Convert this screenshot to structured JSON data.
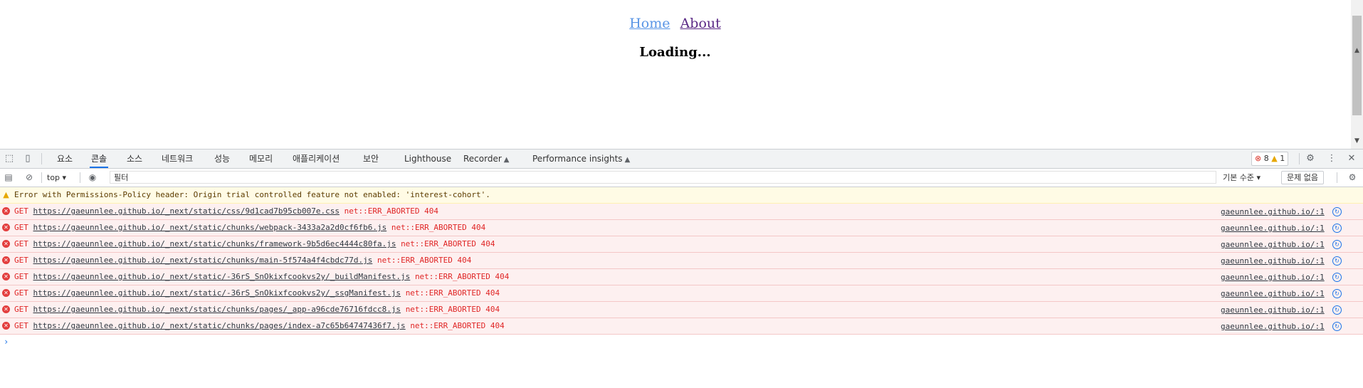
{
  "page": {
    "nav": {
      "home": "Home",
      "about": "About"
    },
    "loading": "Loading..."
  },
  "devtools": {
    "tabs": [
      "요소",
      "콘솔",
      "소스",
      "네트워크",
      "성능",
      "메모리",
      "애플리케이션",
      "보안",
      "Lighthouse",
      "Recorder",
      "Performance insights"
    ],
    "active_tab": "콘솔",
    "error_count": "8",
    "warning_count": "1",
    "toolbar": {
      "context": "top",
      "filter_value": "필터",
      "level": "기본 수준",
      "issues": "문제 없음"
    },
    "warning_row": "Error with Permissions-Policy header: Origin trial controlled feature not enabled: 'interest-cohort'.",
    "error_rows": [
      {
        "method": "GET",
        "url": "https://gaeunnlee.github.io/_next/static/css/9d1cad7b95cb007e.css",
        "status": "net::ERR_ABORTED 404",
        "source": "gaeunnlee.github.io/:1"
      },
      {
        "method": "GET",
        "url": "https://gaeunnlee.github.io/_next/static/chunks/webpack-3433a2a2d0cf6fb6.js",
        "status": "net::ERR_ABORTED 404",
        "source": "gaeunnlee.github.io/:1"
      },
      {
        "method": "GET",
        "url": "https://gaeunnlee.github.io/_next/static/chunks/framework-9b5d6ec4444c80fa.js",
        "status": "net::ERR_ABORTED 404",
        "source": "gaeunnlee.github.io/:1"
      },
      {
        "method": "GET",
        "url": "https://gaeunnlee.github.io/_next/static/chunks/main-5f574a4f4cbdc77d.js",
        "status": "net::ERR_ABORTED 404",
        "source": "gaeunnlee.github.io/:1"
      },
      {
        "method": "GET",
        "url": "https://gaeunnlee.github.io/_next/static/-36rS_SnOkixfcookvs2y/_buildManifest.js",
        "status": "net::ERR_ABORTED 404",
        "source": "gaeunnlee.github.io/:1"
      },
      {
        "method": "GET",
        "url": "https://gaeunnlee.github.io/_next/static/-36rS_SnOkixfcookvs2y/_ssgManifest.js",
        "status": "net::ERR_ABORTED 404",
        "source": "gaeunnlee.github.io/:1"
      },
      {
        "method": "GET",
        "url": "https://gaeunnlee.github.io/_next/static/chunks/pages/_app-a96cde76716fdcc8.js",
        "status": "net::ERR_ABORTED 404",
        "source": "gaeunnlee.github.io/:1"
      },
      {
        "method": "GET",
        "url": "https://gaeunnlee.github.io/_next/static/chunks/pages/index-a7c65b64747436f7.js",
        "status": "net::ERR_ABORTED 404",
        "source": "gaeunnlee.github.io/:1"
      }
    ],
    "prompt": "›"
  }
}
